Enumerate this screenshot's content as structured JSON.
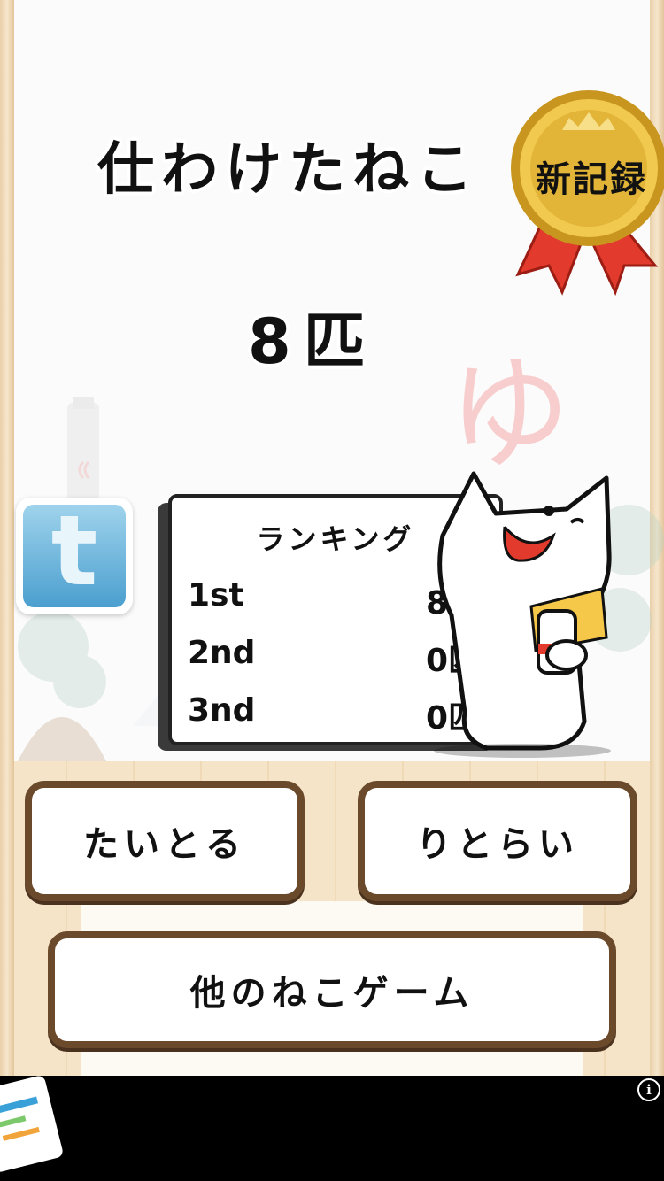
{
  "result": {
    "title": "仕わけたねこ",
    "score": "8匹",
    "medal_label": "新記録",
    "background_char": "ゆ"
  },
  "ranking": {
    "title": "ランキング",
    "rows": [
      {
        "place": "1st",
        "value": "8匹"
      },
      {
        "place": "2nd",
        "value": "0匹"
      },
      {
        "place": "3nd",
        "value": "0匹"
      }
    ]
  },
  "buttons": {
    "title": "たいとる",
    "retry": "りとらい",
    "other_games": "他のねこゲーム"
  },
  "share": {
    "icon": "twitter-icon",
    "glyph": "t"
  },
  "ad": {
    "info_glyph": "i"
  },
  "colors": {
    "button_border": "#6b4a2c",
    "medal_gold": "#e2b437",
    "ribbon_red": "#e23a2c",
    "twitter_blue": "#4b9fcf"
  }
}
